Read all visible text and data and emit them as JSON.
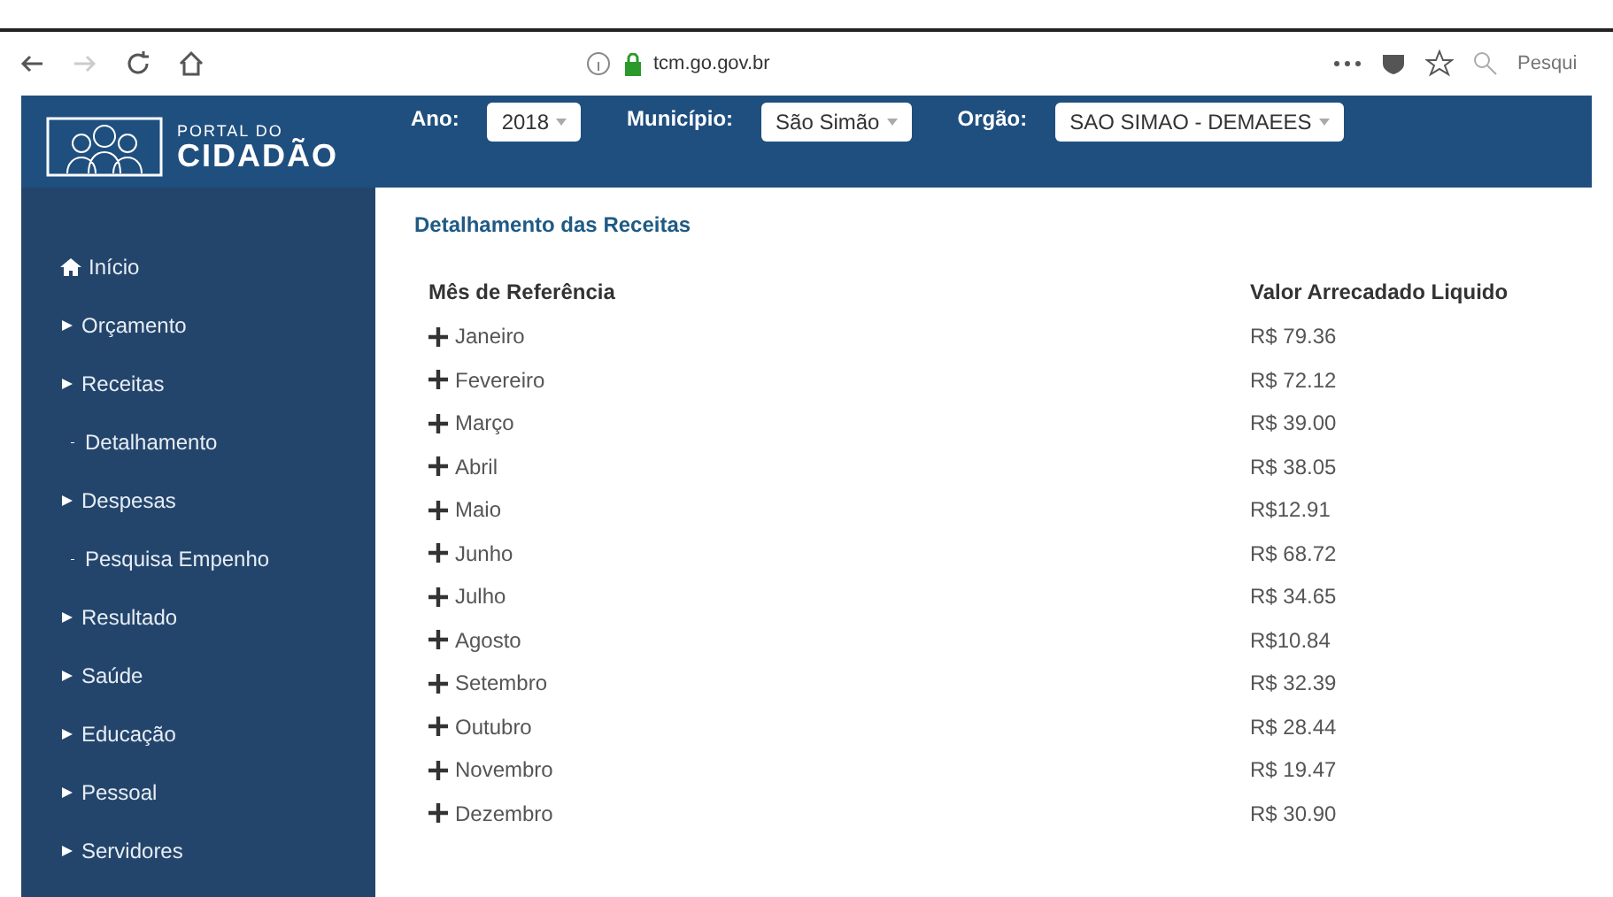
{
  "browser": {
    "url": "tcm.go.gov.br",
    "search_placeholder": "Pesqui"
  },
  "header": {
    "logo_top": "PORTAL DO",
    "logo_bottom": "CIDADÃO",
    "filters": [
      {
        "label": "Ano:",
        "value": "2018"
      },
      {
        "label": "Município:",
        "value": "São Simão"
      },
      {
        "label": "Orgão:",
        "value": "SAO SIMAO - DEMAEES"
      }
    ]
  },
  "sidebar": {
    "items": [
      {
        "label": "Início",
        "kind": "home"
      },
      {
        "label": "Orçamento",
        "kind": "section"
      },
      {
        "label": "Receitas",
        "kind": "section"
      },
      {
        "label": "Detalhamento",
        "kind": "sub"
      },
      {
        "label": "Despesas",
        "kind": "section"
      },
      {
        "label": "Pesquisa Empenho",
        "kind": "sub"
      },
      {
        "label": "Resultado",
        "kind": "section"
      },
      {
        "label": "Saúde",
        "kind": "section"
      },
      {
        "label": "Educação",
        "kind": "section"
      },
      {
        "label": "Pessoal",
        "kind": "section"
      },
      {
        "label": "Servidores",
        "kind": "section"
      }
    ]
  },
  "content": {
    "title": "Detalhamento das Receitas",
    "table": {
      "columns": [
        "Mês de Referência",
        "Valor Arrecadado Liquido"
      ],
      "rows": [
        {
          "month": "Janeiro",
          "value": "R$ 79.36"
        },
        {
          "month": "Fevereiro",
          "value": "R$ 72.12"
        },
        {
          "month": "Março",
          "value": "R$ 39.00"
        },
        {
          "month": "Abril",
          "value": "R$ 38.05"
        },
        {
          "month": "Maio",
          "value": "R$12.91"
        },
        {
          "month": "Junho",
          "value": "R$ 68.72"
        },
        {
          "month": "Julho",
          "value": "R$ 34.65"
        },
        {
          "month": "Agosto",
          "value": "R$10.84"
        },
        {
          "month": "Setembro",
          "value": "R$ 32.39"
        },
        {
          "month": "Outubro",
          "value": "R$ 28.44"
        },
        {
          "month": "Novembro",
          "value": "R$ 19.47"
        },
        {
          "month": "Dezembro",
          "value": "R$ 30.90"
        }
      ]
    }
  }
}
